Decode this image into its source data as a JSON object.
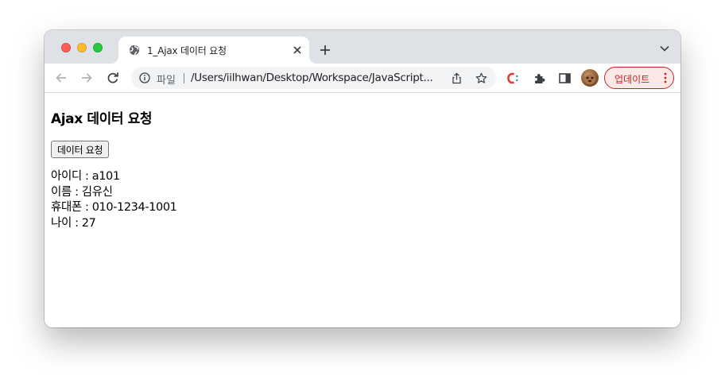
{
  "tab": {
    "title": "1_Ajax 데이터 요청",
    "favicon": "globe-icon"
  },
  "toolbar": {
    "scheme_label": "파일",
    "url": "/Users/iilhwan/Desktop/Workspace/JavaScript...",
    "update_label": "업데이트"
  },
  "page": {
    "title": "Ajax 데이터 요청",
    "button_label": "데이터 요청",
    "results": [
      "아이디 : a101",
      "이름 : 김유신",
      "휴대폰 : 010-1234-1001",
      "나이 : 27"
    ]
  },
  "colors": {
    "tabstrip": "#dee1e6",
    "update_accent": "#c5221f",
    "omnibox": "#f1f3f4"
  }
}
